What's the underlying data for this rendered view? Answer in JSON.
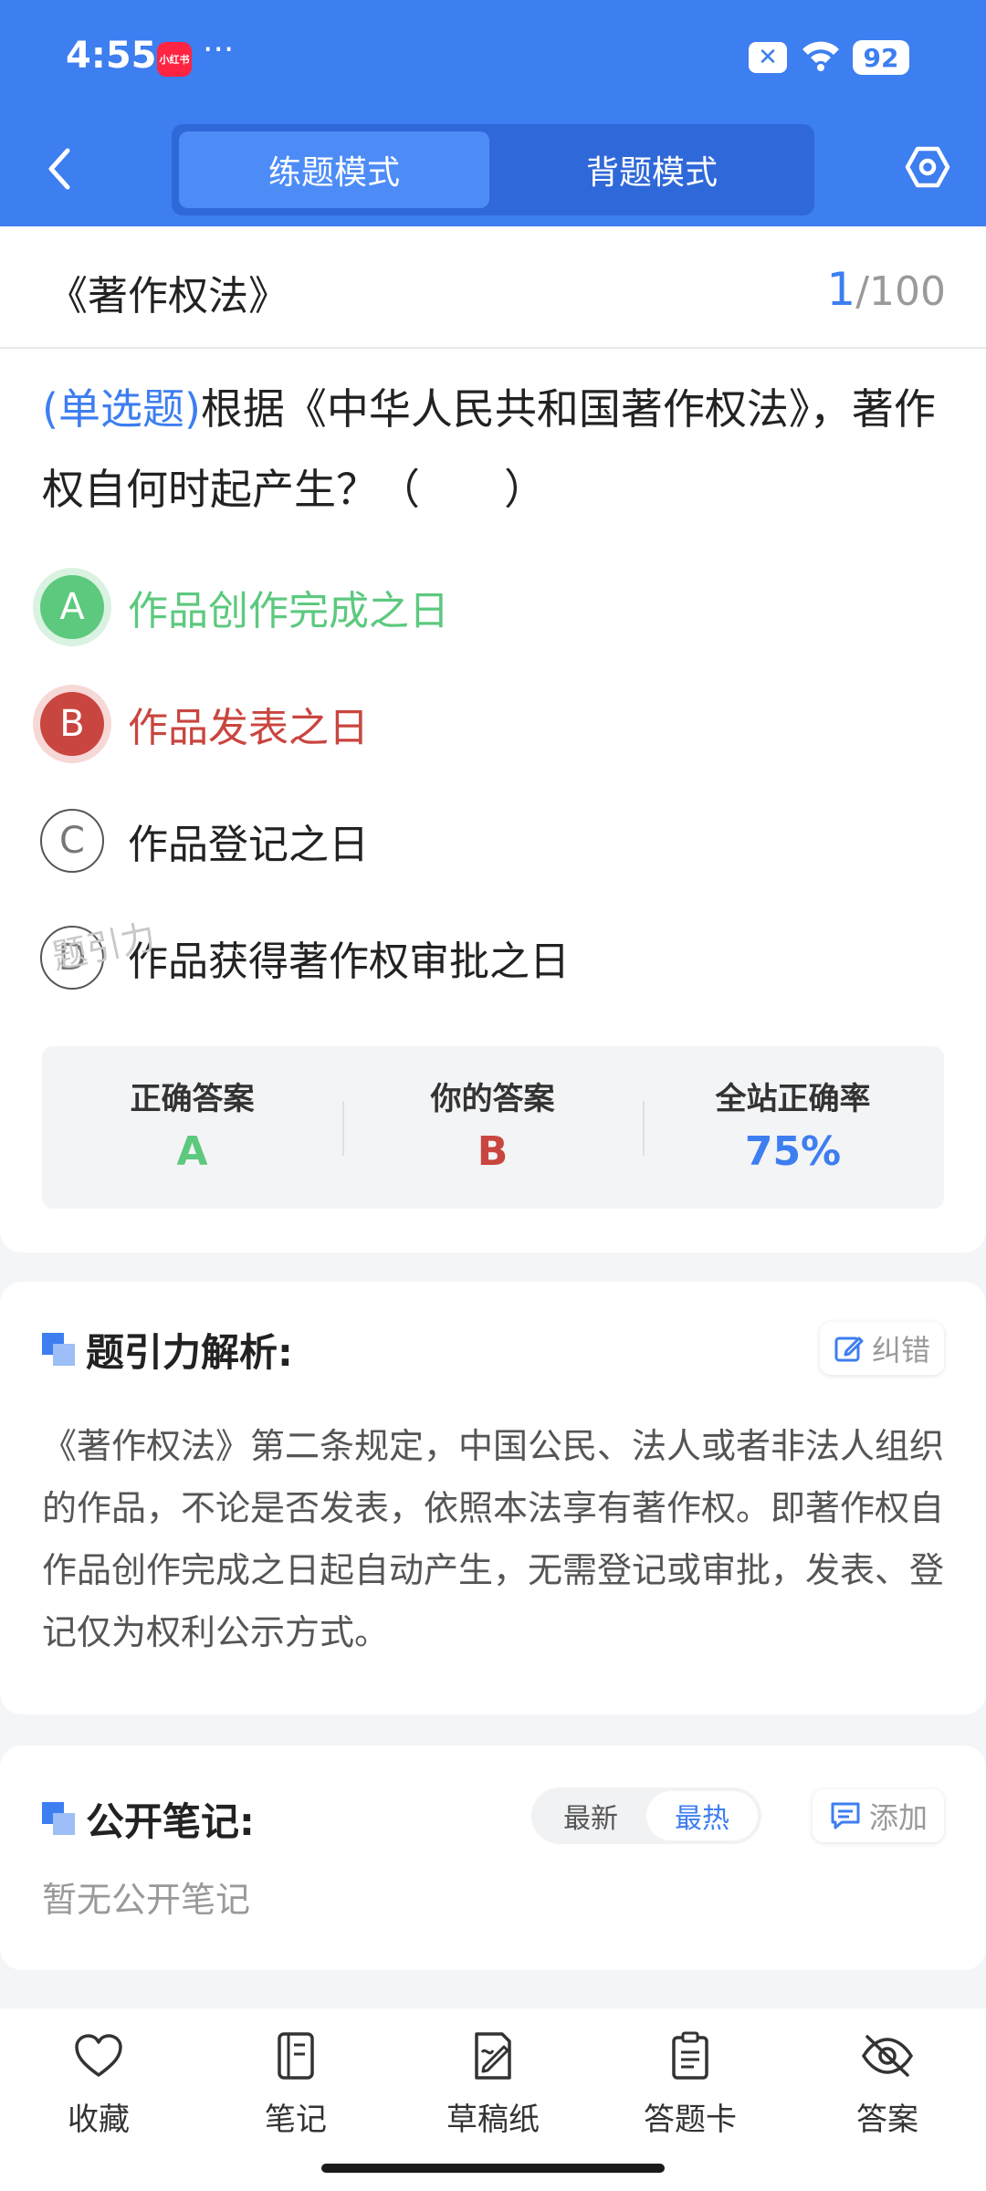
{
  "status_bar": {
    "time": "4:55",
    "app_badge": "小红书",
    "dots": "···",
    "battery": "92"
  },
  "header": {
    "modes": [
      "练题模式",
      "背题模式"
    ],
    "active_mode": "练题模式"
  },
  "question_card": {
    "chapter_title": "《著作权法》",
    "counter_current": "1",
    "counter_total": "/100",
    "question_type": "(单选题)",
    "question_text": "根据《中华人民共和国著作权法》，著作权自何时起产生？（　　）",
    "options": [
      {
        "letter": "A",
        "text": "作品创作完成之日",
        "state": "correct"
      },
      {
        "letter": "B",
        "text": "作品发表之日",
        "state": "wrong"
      },
      {
        "letter": "C",
        "text": "作品登记之日",
        "state": "normal"
      },
      {
        "letter": "D",
        "text": "作品获得著作权审批之日",
        "state": "normal"
      }
    ],
    "answer_summary": {
      "correct_label": "正确答案",
      "correct_value": "A",
      "yours_label": "你的答案",
      "yours_value": "B",
      "rate_label": "全站正确率",
      "rate_value": "75%"
    },
    "watermark": "题引力",
    "colors": {
      "correct": "#5cc97e",
      "wrong": "#c9453f",
      "accent": "#3d7ef0"
    }
  },
  "analysis": {
    "title": "题引力解析:",
    "report_label": "纠错",
    "text": "《著作权法》第二条规定，中国公民、法人或者非法人组织的作品，不论是否发表，依照本法享有著作权。即著作权自作品创作完成之日起自动产生，无需登记或审批，发表、登记仅为权利公示方式。"
  },
  "notes": {
    "title": "公开笔记:",
    "sort_options": [
      "最新",
      "最热"
    ],
    "active_sort": "最热",
    "add_label": "添加",
    "empty_text": "暂无公开笔记"
  },
  "bottom_nav": [
    {
      "label": "收藏",
      "icon": "heart-icon"
    },
    {
      "label": "笔记",
      "icon": "notebook-icon"
    },
    {
      "label": "草稿纸",
      "icon": "draft-paper-icon"
    },
    {
      "label": "答题卡",
      "icon": "answer-sheet-icon"
    },
    {
      "label": "答案",
      "icon": "eye-off-icon"
    }
  ]
}
